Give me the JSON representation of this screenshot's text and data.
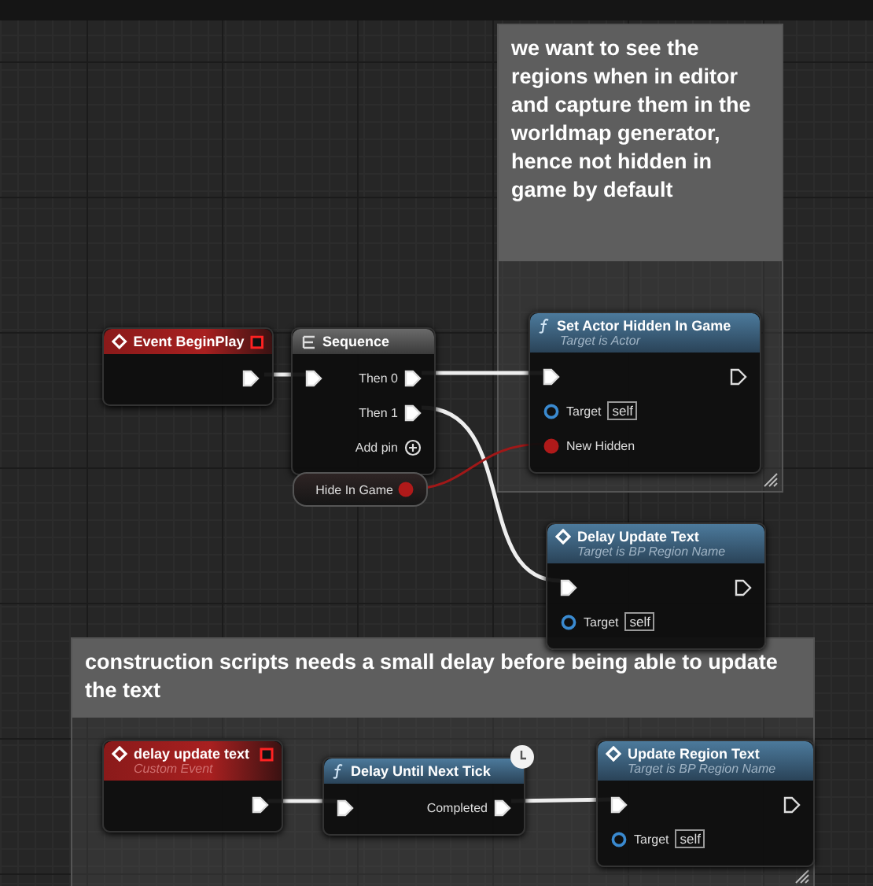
{
  "comments": [
    {
      "text": "we want to see the regions when in editor and capture them in the worldmap generator, hence not hidden in game by default"
    },
    {
      "text": "construction scripts needs a small delay before being able to update the text"
    }
  ],
  "nodes": [
    {
      "kind": "event",
      "title": "Event BeginPlay",
      "rows": [
        {
          "out": {
            "kind": "exec",
            "connected": true
          }
        }
      ]
    },
    {
      "kind": "sequence",
      "title": "Sequence",
      "rows": [
        {
          "in": {
            "kind": "exec",
            "connected": true
          },
          "out": {
            "kind": "exec",
            "connected": true,
            "label": "Then 0"
          }
        },
        {
          "out": {
            "kind": "exec",
            "connected": true,
            "label": "Then 1"
          }
        },
        {
          "out": {
            "kind": "add",
            "connected": false,
            "label": "Add pin"
          }
        }
      ]
    },
    {
      "kind": "variable",
      "title": "Hide In Game",
      "rows": [
        {
          "out": {
            "kind": "bool",
            "connected": true
          }
        }
      ]
    },
    {
      "kind": "function",
      "title": "Set Actor Hidden In Game",
      "subtitle": "Target is Actor",
      "rows": [
        {
          "in": {
            "kind": "exec",
            "connected": true
          },
          "out": {
            "kind": "exec",
            "connected": false
          }
        },
        {
          "in": {
            "kind": "object",
            "connected": false,
            "label": "Target",
            "value": "self"
          }
        },
        {
          "in": {
            "kind": "bool",
            "connected": true,
            "label": "New Hidden"
          }
        }
      ]
    },
    {
      "kind": "call",
      "title": "Delay Update Text",
      "subtitle": "Target is BP Region Name",
      "rows": [
        {
          "in": {
            "kind": "exec",
            "connected": true
          },
          "out": {
            "kind": "exec",
            "connected": false
          }
        },
        {
          "in": {
            "kind": "object",
            "connected": false,
            "label": "Target",
            "value": "self"
          }
        }
      ]
    },
    {
      "kind": "event",
      "title": "delay update text",
      "subtitle": "Custom Event",
      "rows": [
        {
          "out": {
            "kind": "exec",
            "connected": true
          }
        }
      ]
    },
    {
      "kind": "function",
      "title": "Delay Until Next Tick",
      "latent": true,
      "rows": [
        {
          "in": {
            "kind": "exec",
            "connected": true
          },
          "out": {
            "kind": "exec",
            "connected": true,
            "label": "Completed"
          }
        }
      ]
    },
    {
      "kind": "call",
      "title": "Update Region Text",
      "subtitle": "Target is BP Region Name",
      "rows": [
        {
          "in": {
            "kind": "exec",
            "connected": true
          },
          "out": {
            "kind": "exec",
            "connected": false
          }
        },
        {
          "in": {
            "kind": "object",
            "connected": false,
            "label": "Target",
            "value": "self"
          }
        }
      ]
    }
  ]
}
